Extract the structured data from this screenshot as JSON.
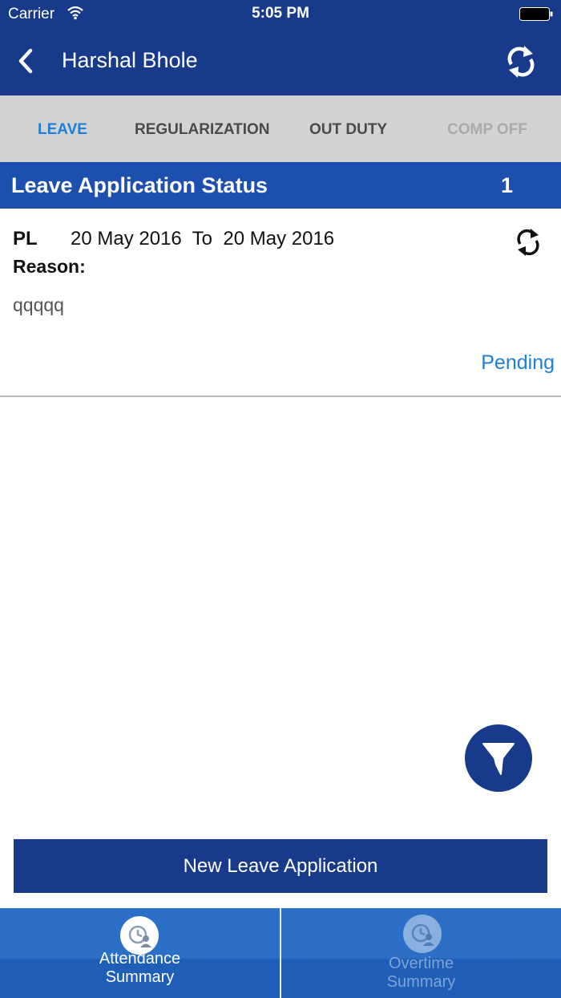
{
  "status_bar": {
    "carrier": "Carrier",
    "time": "5:05 PM",
    "icons": [
      "wifi-icon",
      "battery-icon"
    ]
  },
  "nav": {
    "title": "Harshal Bhole",
    "back_icon": "chevron-left-icon",
    "refresh_icon": "refresh-icon"
  },
  "tabs": [
    {
      "label": "LEAVE",
      "state": "active"
    },
    {
      "label": "REGULARIZATION",
      "state": "normal"
    },
    {
      "label": "OUT DUTY",
      "state": "normal"
    },
    {
      "label": "COMP OFF",
      "state": "disabled"
    }
  ],
  "section": {
    "title": "Leave Application Status",
    "count": "1"
  },
  "application": {
    "type": "PL",
    "from": "20 May 2016",
    "to_word": "To",
    "to": "20 May 2016",
    "reason_label": "Reason:",
    "reason": "qqqqq",
    "status": "Pending",
    "refresh_icon": "refresh-icon"
  },
  "filter_button": {
    "icon": "filter-icon"
  },
  "new_button": {
    "label": "New Leave Application"
  },
  "bottom_tabs": [
    {
      "label_line1": "Attendance",
      "label_line2": "Summary",
      "icon": "attendance-summary-icon",
      "state": "active"
    },
    {
      "label_line1": "Overtime",
      "label_line2": "Summary",
      "icon": "overtime-summary-icon",
      "state": "inactive"
    }
  ],
  "colors": {
    "primary": "#173a8a",
    "section_header": "#1d4fae",
    "accent": "#1e7fd9",
    "tab_bar": "#d3d3d3",
    "bottom_bar": "#2b6fc7"
  }
}
